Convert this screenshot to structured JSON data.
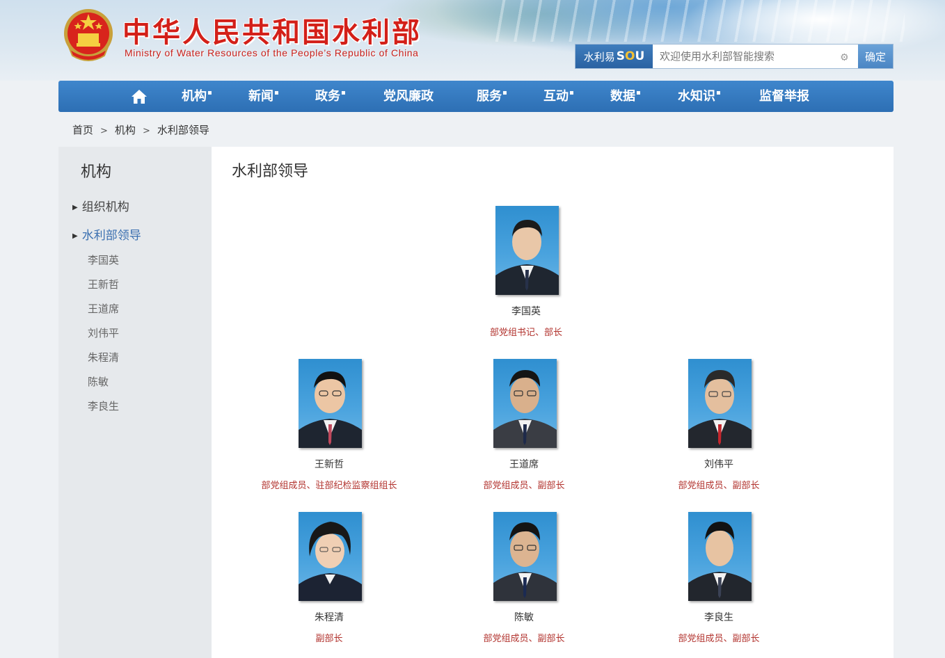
{
  "header": {
    "title_cn": "中华人民共和国水利部",
    "title_en": "Ministry of Water Resources of the People’s Republic of China"
  },
  "search": {
    "brand_prefix": "水利易",
    "brand_s": "S",
    "brand_o": "O",
    "brand_u": "U",
    "placeholder": "欢迎使用水利部智能搜索",
    "submit_label": "确定"
  },
  "nav": {
    "items": [
      {
        "label": "机构",
        "has_menu": "true"
      },
      {
        "label": "新闻",
        "has_menu": "true"
      },
      {
        "label": "政务",
        "has_menu": "true"
      },
      {
        "label": "党风廉政",
        "has_menu": "false"
      },
      {
        "label": "服务",
        "has_menu": "true"
      },
      {
        "label": "互动",
        "has_menu": "true"
      },
      {
        "label": "数据",
        "has_menu": "true"
      },
      {
        "label": "水知识",
        "has_menu": "true"
      },
      {
        "label": "监督举报",
        "has_menu": "false"
      }
    ],
    "caret": "▪"
  },
  "breadcrumb": {
    "home": "首页",
    "level1": "机构",
    "level2": "水利部领导",
    "sep": ">"
  },
  "sidebar": {
    "title": "机构",
    "categories": [
      {
        "label": "组织机构"
      },
      {
        "label": "水利部领导"
      }
    ],
    "leaders": [
      "李国英",
      "王新哲",
      "王道席",
      "刘伟平",
      "朱程清",
      "陈敏",
      "李良生"
    ]
  },
  "main": {
    "title": "水利部领导",
    "leaders": [
      {
        "name": "李国英",
        "role": "部党组书记、部长"
      },
      {
        "name": "王新哲",
        "role": "部党组成员、驻部纪检监察组组长"
      },
      {
        "name": "王道席",
        "role": "部党组成员、副部长"
      },
      {
        "name": "刘伟平",
        "role": "部党组成员、副部长"
      },
      {
        "name": "朱程清",
        "role": "副部长"
      },
      {
        "name": "陈敏",
        "role": "部党组成员、副部长"
      },
      {
        "name": "李良生",
        "role": "部党组成员、副部长"
      }
    ]
  },
  "icons": {
    "home": "home-icon",
    "emblem": "national-emblem-icon",
    "settings": "gear-icon",
    "triangle": "triangle-right-icon"
  },
  "colors": {
    "nav_blue": "#2d6fb4",
    "title_red": "#d32019",
    "role_red": "#b2332e",
    "active_blue": "#3a6fb0"
  }
}
